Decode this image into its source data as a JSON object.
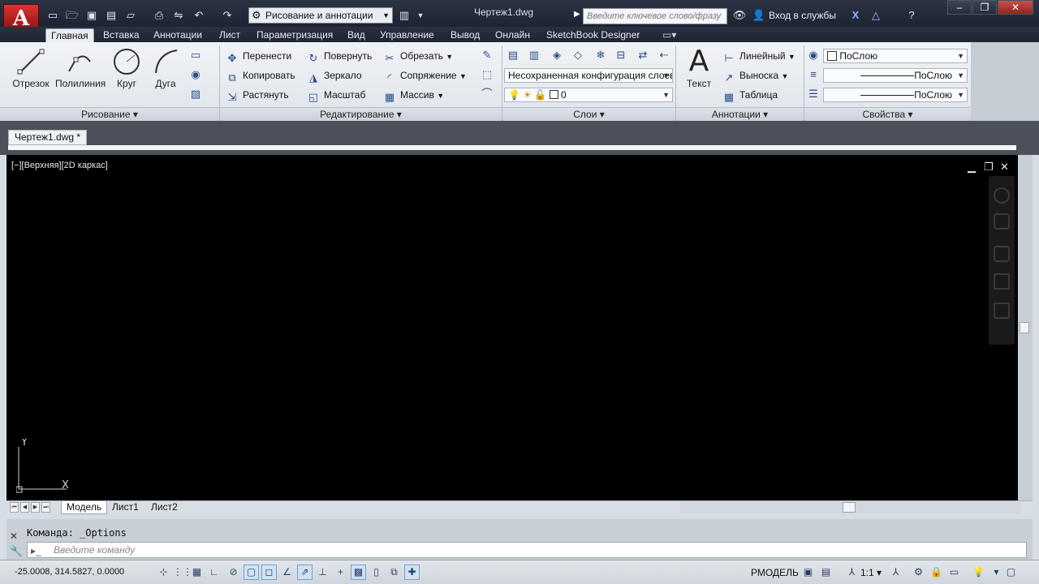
{
  "app": {
    "logo_letter": "A",
    "document_title": "Чертеж1.dwg",
    "workspace": "Рисование и аннотации",
    "search_placeholder": "Введите ключевое слово/фразу",
    "signin_label": "Вход в службы",
    "window_controls": [
      "–",
      "❐",
      "✕"
    ]
  },
  "tabs": [
    {
      "label": "Главная",
      "active": true
    },
    {
      "label": "Вставка"
    },
    {
      "label": "Аннотации"
    },
    {
      "label": "Лист"
    },
    {
      "label": "Параметризация"
    },
    {
      "label": "Вид"
    },
    {
      "label": "Управление"
    },
    {
      "label": "Вывод"
    },
    {
      "label": "Онлайн"
    },
    {
      "label": "SketchBook Designer"
    }
  ],
  "ribbon": {
    "draw": {
      "title": "Рисование",
      "tools": [
        "Отрезок",
        "Полилиния",
        "Круг",
        "Дуга"
      ]
    },
    "modify": {
      "title": "Редактирование",
      "col1": [
        "Перенести",
        "Копировать",
        "Растянуть"
      ],
      "col2": [
        "Повернуть",
        "Зеркало",
        "Масштаб"
      ],
      "col3": [
        "Обрезать",
        "Сопряжение",
        "Массив"
      ]
    },
    "layers": {
      "title": "Слои",
      "layer_state": "Несохраненная конфигурация слоев",
      "current_layer": "0"
    },
    "annotation": {
      "title": "Аннотации",
      "text_tool": "Текст",
      "items": [
        "Линейный",
        "Выноска",
        "Таблица"
      ]
    },
    "properties": {
      "title": "Свойства",
      "color": "ПоСлою",
      "lineweight": "ПоСлою",
      "linetype": "ПоСлою"
    }
  },
  "document": {
    "tab_label": "Чертеж1.dwg *",
    "viewport_label": "[−][Верхняя][2D каркас]",
    "ucs_y": "Y",
    "ucs_x": "X"
  },
  "layout_tabs": [
    {
      "label": "Модель",
      "active": true
    },
    {
      "label": "Лист1"
    },
    {
      "label": "Лист2"
    }
  ],
  "command": {
    "history": "Команда:  _Options",
    "placeholder": "Введите команду"
  },
  "status": {
    "coords": "-25.0008, 314.5827, 0.0000",
    "model_label": "РМОДЕЛЬ",
    "scale": "1:1"
  }
}
